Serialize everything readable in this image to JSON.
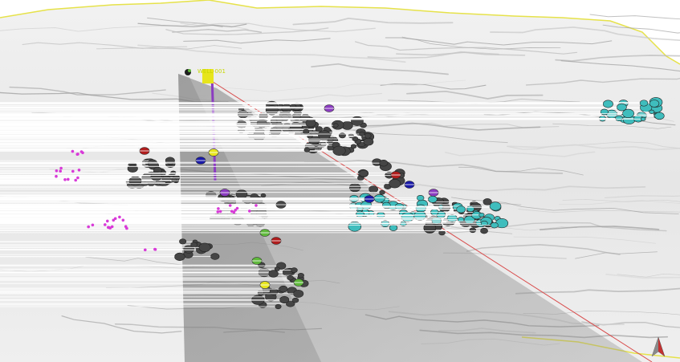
{
  "viewer": {
    "well_label": "WELL-001"
  },
  "colors": {
    "terrain": "#e9e9e9",
    "terrain_edge": "#e6e24a",
    "section_plane": "#8e8e8e",
    "section_line": "#d84a4a",
    "cluster_dark": "#454545",
    "cluster_cyan": "#3fbdbd",
    "markers_magenta": "#d83ad8",
    "well_yellow": "#e7e51c",
    "accent_blue": "#1a1aa8",
    "accent_red": "#b01d1d",
    "accent_green": "#5fb83b",
    "accent_purple": "#8b3cc0"
  },
  "icons": {
    "north_arrow": "north-arrow-icon"
  }
}
